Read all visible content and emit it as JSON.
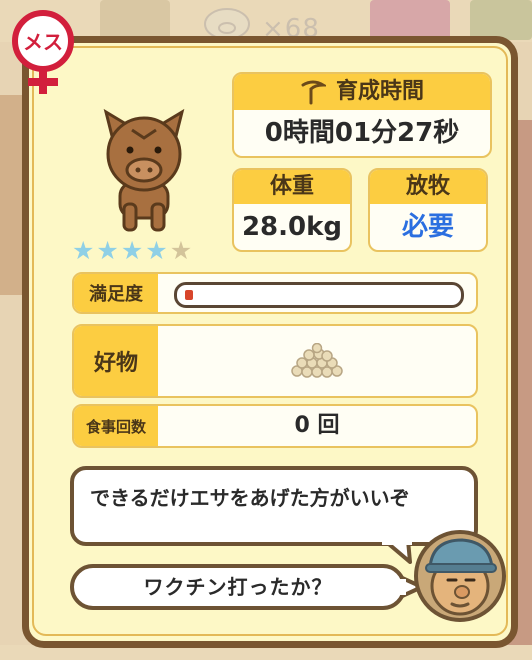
{
  "background": {
    "pig_counter": "×68"
  },
  "gender": {
    "label": "メス",
    "color": "#d21f3c"
  },
  "stars": {
    "rating": 4,
    "max": 5
  },
  "growth": {
    "label": "育成時間",
    "value": "0時間01分27秒"
  },
  "weight": {
    "label": "体重",
    "value": "28.0kg"
  },
  "grazing": {
    "label": "放牧",
    "value": "必要",
    "value_color": "#2b6fe0"
  },
  "satisfaction": {
    "label": "満足度",
    "level": 0.03
  },
  "favorite": {
    "label": "好物",
    "icon": "grain-pile-icon"
  },
  "meals": {
    "label": "食事回数",
    "value": "0 回"
  },
  "dialogue": {
    "line1": "できるだけエサをあげた方がいいぞ",
    "line2": "ワクチン打ったか？"
  },
  "colors": {
    "header": "#fccd41",
    "panel": "#fdf8c6",
    "frame": "#7a5630",
    "accent_blue": "#2b6fe0"
  }
}
